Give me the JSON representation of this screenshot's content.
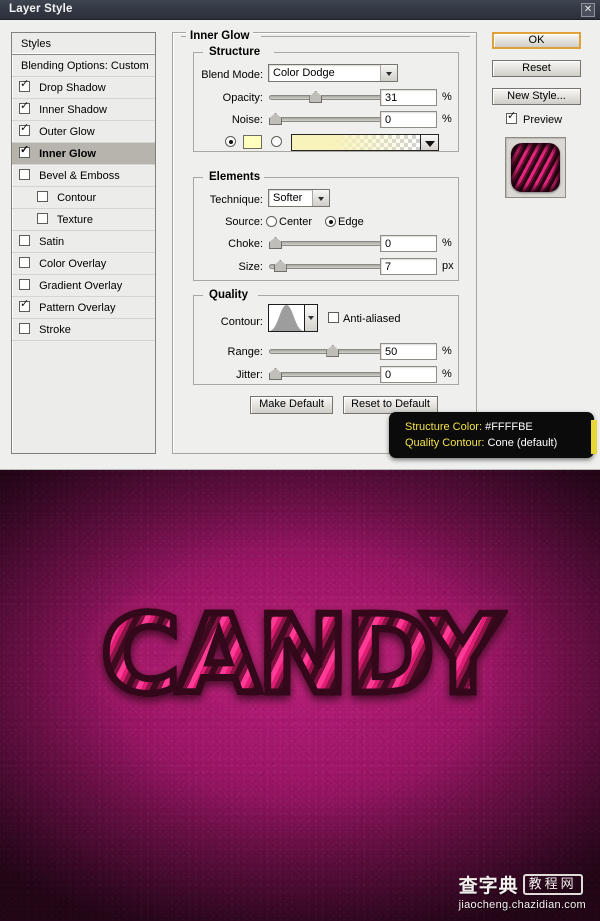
{
  "window": {
    "title": "Layer Style",
    "close_icon": "close-x-icon"
  },
  "styles_panel": {
    "header": "Styles",
    "blending_options": "Blending Options: Custom",
    "items": [
      {
        "label": "Drop Shadow",
        "checked": true,
        "indent": false,
        "selected": false
      },
      {
        "label": "Inner Shadow",
        "checked": true,
        "indent": false,
        "selected": false
      },
      {
        "label": "Outer Glow",
        "checked": true,
        "indent": false,
        "selected": false
      },
      {
        "label": "Inner Glow",
        "checked": true,
        "indent": false,
        "selected": true
      },
      {
        "label": "Bevel & Emboss",
        "checked": false,
        "indent": false,
        "selected": false
      },
      {
        "label": "Contour",
        "checked": false,
        "indent": true,
        "selected": false
      },
      {
        "label": "Texture",
        "checked": false,
        "indent": true,
        "selected": false
      },
      {
        "label": "Satin",
        "checked": false,
        "indent": false,
        "selected": false
      },
      {
        "label": "Color Overlay",
        "checked": false,
        "indent": false,
        "selected": false
      },
      {
        "label": "Gradient Overlay",
        "checked": false,
        "indent": false,
        "selected": false
      },
      {
        "label": "Pattern Overlay",
        "checked": true,
        "indent": false,
        "selected": false
      },
      {
        "label": "Stroke",
        "checked": false,
        "indent": false,
        "selected": false
      }
    ]
  },
  "effect": {
    "title": "Inner Glow",
    "structure": {
      "legend": "Structure",
      "blend_mode_label": "Blend Mode:",
      "blend_mode_value": "Color Dodge",
      "opacity_label": "Opacity:",
      "opacity_value": "31",
      "opacity_unit": "%",
      "noise_label": "Noise:",
      "noise_value": "0",
      "noise_unit": "%",
      "color_swatch_hex": "#FFFFBE",
      "fill_mode": "solid-color",
      "gradient_dropdown_icon": "chevron-down-icon"
    },
    "elements": {
      "legend": "Elements",
      "technique_label": "Technique:",
      "technique_value": "Softer",
      "source_label": "Source:",
      "source_center": "Center",
      "source_edge": "Edge",
      "source_selected": "Edge",
      "choke_label": "Choke:",
      "choke_value": "0",
      "choke_unit": "%",
      "size_label": "Size:",
      "size_value": "7",
      "size_unit": "px"
    },
    "quality": {
      "legend": "Quality",
      "contour_label": "Contour:",
      "contour_preset": "Cone",
      "contour_dropdown_icon": "chevron-down-icon",
      "anti_aliased_label": "Anti-aliased",
      "anti_aliased_checked": false,
      "range_label": "Range:",
      "range_value": "50",
      "range_unit": "%",
      "jitter_label": "Jitter:",
      "jitter_value": "0",
      "jitter_unit": "%"
    },
    "make_default": "Make Default",
    "reset_to_default": "Reset to Default"
  },
  "actions": {
    "ok": "OK",
    "reset": "Reset",
    "new_style": "New Style...",
    "preview": "Preview",
    "preview_checked": true,
    "ok_highlight_color": "#e0a03a"
  },
  "tooltip": {
    "line1_key": "Structure Color:",
    "line1_value": "#FFFFBE",
    "line2_key": "Quality Contour:",
    "line2_value": "Cone (default)"
  },
  "artwork": {
    "text": "CANDY",
    "background_color": "#9c1566",
    "stripe_light": "#ff3b95",
    "stripe_dark": "#33081a"
  },
  "watermark": {
    "brand_cn": "查字典",
    "brand_box": "教程网",
    "url": "jiaocheng.chazidian.com"
  }
}
